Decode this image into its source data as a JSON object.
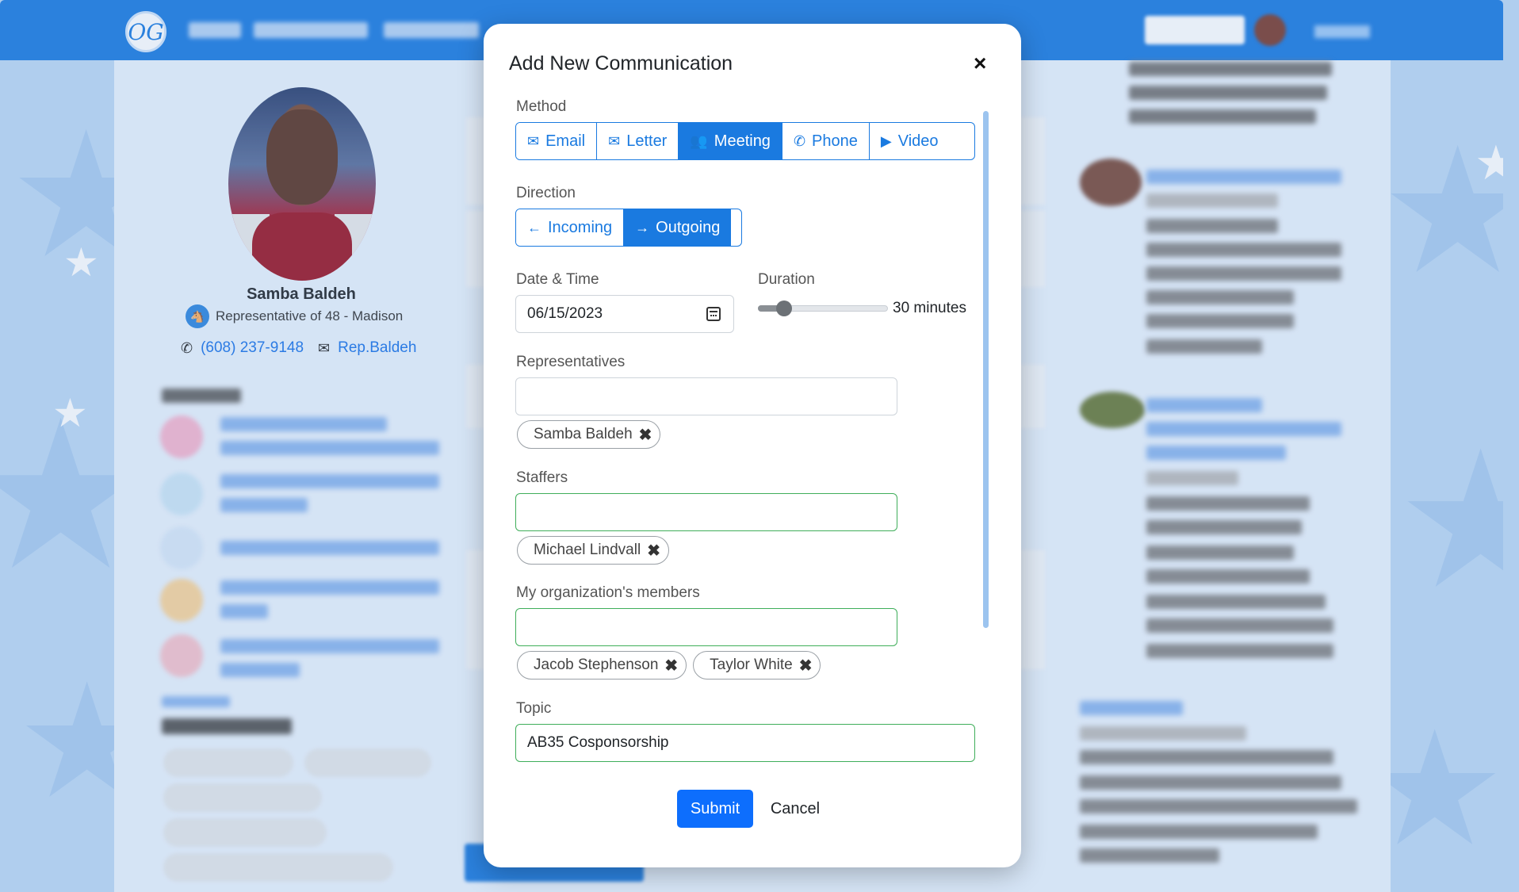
{
  "background": {
    "logo_text": "OG",
    "profile": {
      "name": "Samba Baldeh",
      "district": "Representative of 48 - Madison",
      "phone": "(608) 237-9148",
      "email": "Rep.Baldeh"
    }
  },
  "modal": {
    "title": "Add New Communication",
    "close_label": "×",
    "method": {
      "label": "Method",
      "options": [
        {
          "label": "Email",
          "icon": "envelope-icon",
          "icon_glyph": "✉",
          "active": false
        },
        {
          "label": "Letter",
          "icon": "envelope-icon",
          "icon_glyph": "✉",
          "active": false
        },
        {
          "label": "Meeting",
          "icon": "users-icon",
          "icon_glyph": "👥",
          "active": true
        },
        {
          "label": "Phone",
          "icon": "phone-icon",
          "icon_glyph": "✆",
          "active": false
        },
        {
          "label": "Video",
          "icon": "video-camera-icon",
          "icon_glyph": "▶",
          "active": false
        }
      ]
    },
    "direction": {
      "label": "Direction",
      "options": [
        {
          "label": "Incoming",
          "icon": "arrow-left-icon",
          "icon_glyph": "←",
          "active": false
        },
        {
          "label": "Outgoing",
          "icon": "arrow-right-icon",
          "icon_glyph": "→",
          "active": true
        }
      ]
    },
    "datetime": {
      "label": "Date & Time",
      "value": "06/15/2023"
    },
    "duration": {
      "label": "Duration",
      "value_text": "30 minutes",
      "fraction": 0.2
    },
    "representatives": {
      "label": "Representatives",
      "value": "",
      "chips": [
        "Samba Baldeh"
      ]
    },
    "staffers": {
      "label": "Staffers",
      "value": "",
      "chips": [
        "Michael Lindvall"
      ]
    },
    "members": {
      "label": "My organization's members",
      "value": "",
      "chips": [
        "Jacob Stephenson",
        "Taylor White"
      ]
    },
    "topic": {
      "label": "Topic",
      "value": "AB35 Cosponsorship"
    },
    "submit_label": "Submit",
    "cancel_label": "Cancel"
  },
  "colors": {
    "primary": "#1a7ae0",
    "submit": "#0d6efd",
    "valid_border": "#3fae5a"
  }
}
